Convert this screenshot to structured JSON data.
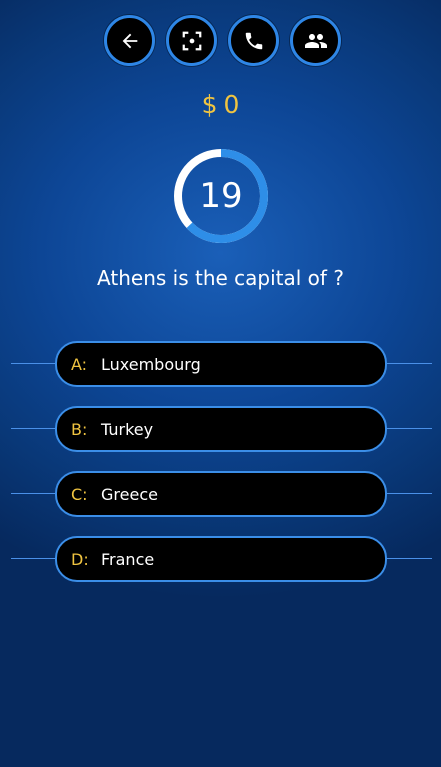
{
  "toolbar": {
    "buttons": [
      {
        "icon": "back-arrow-icon"
      },
      {
        "icon": "fifty-fifty-icon"
      },
      {
        "icon": "phone-icon"
      },
      {
        "icon": "audience-icon"
      }
    ]
  },
  "prize": {
    "symbol": "$",
    "amount": "0"
  },
  "timer": {
    "value": "19",
    "remaining_fraction": 0.63
  },
  "question": {
    "text": "Athens is the capital of ?"
  },
  "answers": [
    {
      "letter": "A:",
      "text": "Luxembourg"
    },
    {
      "letter": "B:",
      "text": "Turkey"
    },
    {
      "letter": "C:",
      "text": "Greece"
    },
    {
      "letter": "D:",
      "text": "France"
    }
  ],
  "colors": {
    "accent": "#2e86e6",
    "gold": "#f0c441",
    "answer_background": "#000000",
    "timer_track": "#ffffff"
  }
}
